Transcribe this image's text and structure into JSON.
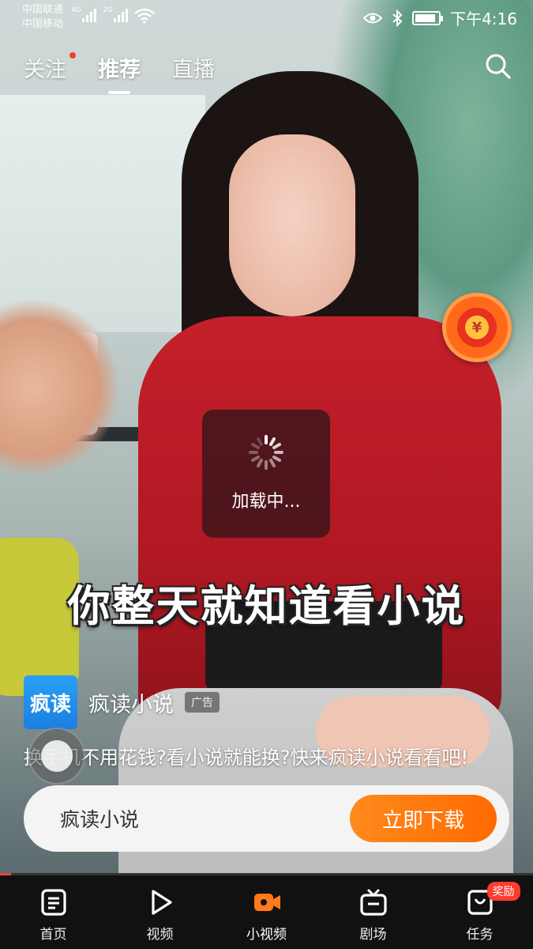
{
  "status_bar": {
    "carrier_1": "中国联通",
    "carrier_2": "中国移动",
    "net_1": "4G",
    "net_2": "2G",
    "time": "下午4:16",
    "battery_level": 0.9
  },
  "top_tabs": [
    {
      "label": "关注",
      "has_dot": true
    },
    {
      "label": "推荐",
      "active": true
    },
    {
      "label": "直播"
    }
  ],
  "loading": {
    "text": "加载中..."
  },
  "subtitle": "你整天就知道看小说",
  "ad": {
    "logo_text": "疯读",
    "app_name": "疯读小说",
    "badge": "广告",
    "description": "换手机不用花钱?看小说就能换?快来疯读小说看看吧!",
    "cta_name": "疯读小说",
    "cta_button": "立即下载"
  },
  "progress": 0.02,
  "bottom_nav": [
    {
      "label": "首页",
      "icon": "home-icon"
    },
    {
      "label": "视频",
      "icon": "play-icon"
    },
    {
      "label": "小视频",
      "icon": "short-video-icon",
      "active": true
    },
    {
      "label": "剧场",
      "icon": "tv-icon"
    },
    {
      "label": "任务",
      "icon": "task-icon",
      "badge": "奖励"
    }
  ],
  "colors": {
    "accent": "#ff6a00",
    "active_nav": "#ff7a1a",
    "dot": "#ff3b30"
  }
}
